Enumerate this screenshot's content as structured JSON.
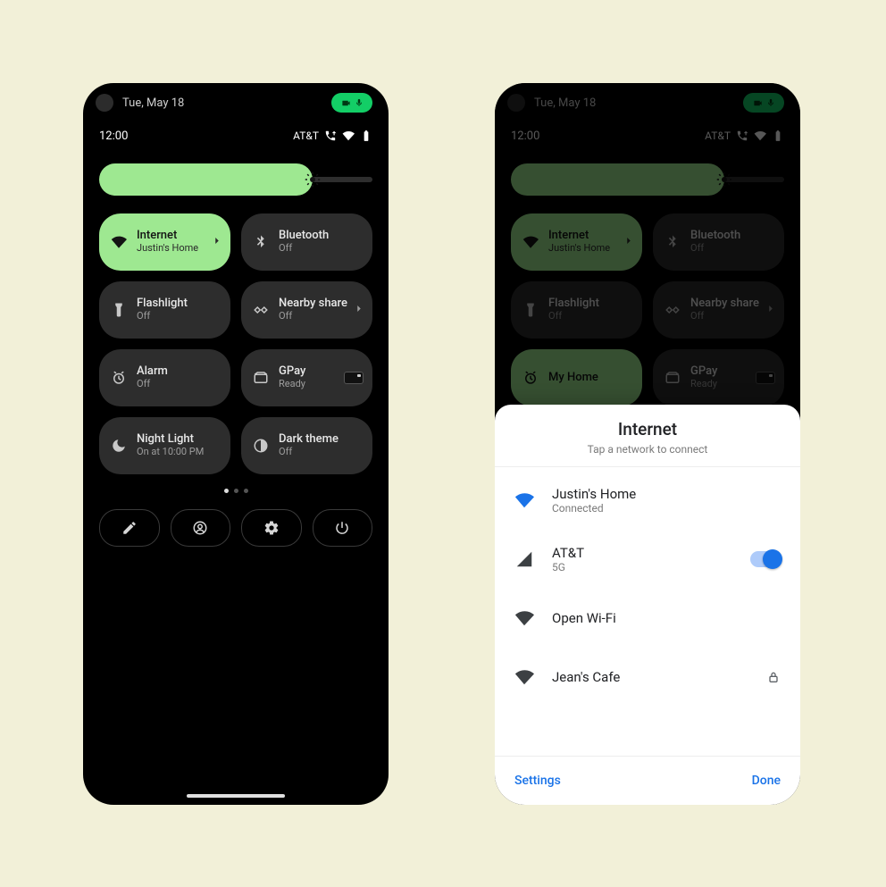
{
  "status": {
    "date": "Tue, May 18",
    "time": "12:00",
    "carrier": "AT&T"
  },
  "slider": {
    "percent": 78
  },
  "tiles": [
    {
      "key": "internet",
      "title": "Internet",
      "sub": "Justin's Home",
      "active": true,
      "chev": true
    },
    {
      "key": "bluetooth",
      "title": "Bluetooth",
      "sub": "Off",
      "active": false,
      "chev": false
    },
    {
      "key": "flashlight",
      "title": "Flashlight",
      "sub": "Off",
      "active": false,
      "chev": false
    },
    {
      "key": "nearby",
      "title": "Nearby share",
      "sub": "Off",
      "active": false,
      "chev": true
    },
    {
      "key": "alarm",
      "title": "Alarm",
      "sub": "Off",
      "active": false,
      "chev": false
    },
    {
      "key": "gpay",
      "title": "GPay",
      "sub": "Ready",
      "active": false,
      "chev": false
    },
    {
      "key": "night",
      "title": "Night Light",
      "sub": "On at 10:00 PM",
      "active": false,
      "chev": false
    },
    {
      "key": "dark",
      "title": "Dark theme",
      "sub": "Off",
      "active": false,
      "chev": false
    }
  ],
  "right_tiles_override": {
    "4": {
      "title": "My Home",
      "sub": "",
      "active": true
    }
  },
  "sheet": {
    "title": "Internet",
    "subtitle": "Tap a network to connect",
    "networks": [
      {
        "name": "Justin's Home",
        "sub": "Connected",
        "icon": "wifi-blue"
      },
      {
        "name": "AT&T",
        "sub": "5G",
        "icon": "cell",
        "toggle": true
      },
      {
        "name": "Open Wi-Fi",
        "sub": "",
        "icon": "wifi-dark"
      },
      {
        "name": "Jean's Cafe",
        "sub": "",
        "icon": "wifi-dark",
        "locked": true
      }
    ],
    "left_btn": "Settings",
    "right_btn": "Done"
  }
}
